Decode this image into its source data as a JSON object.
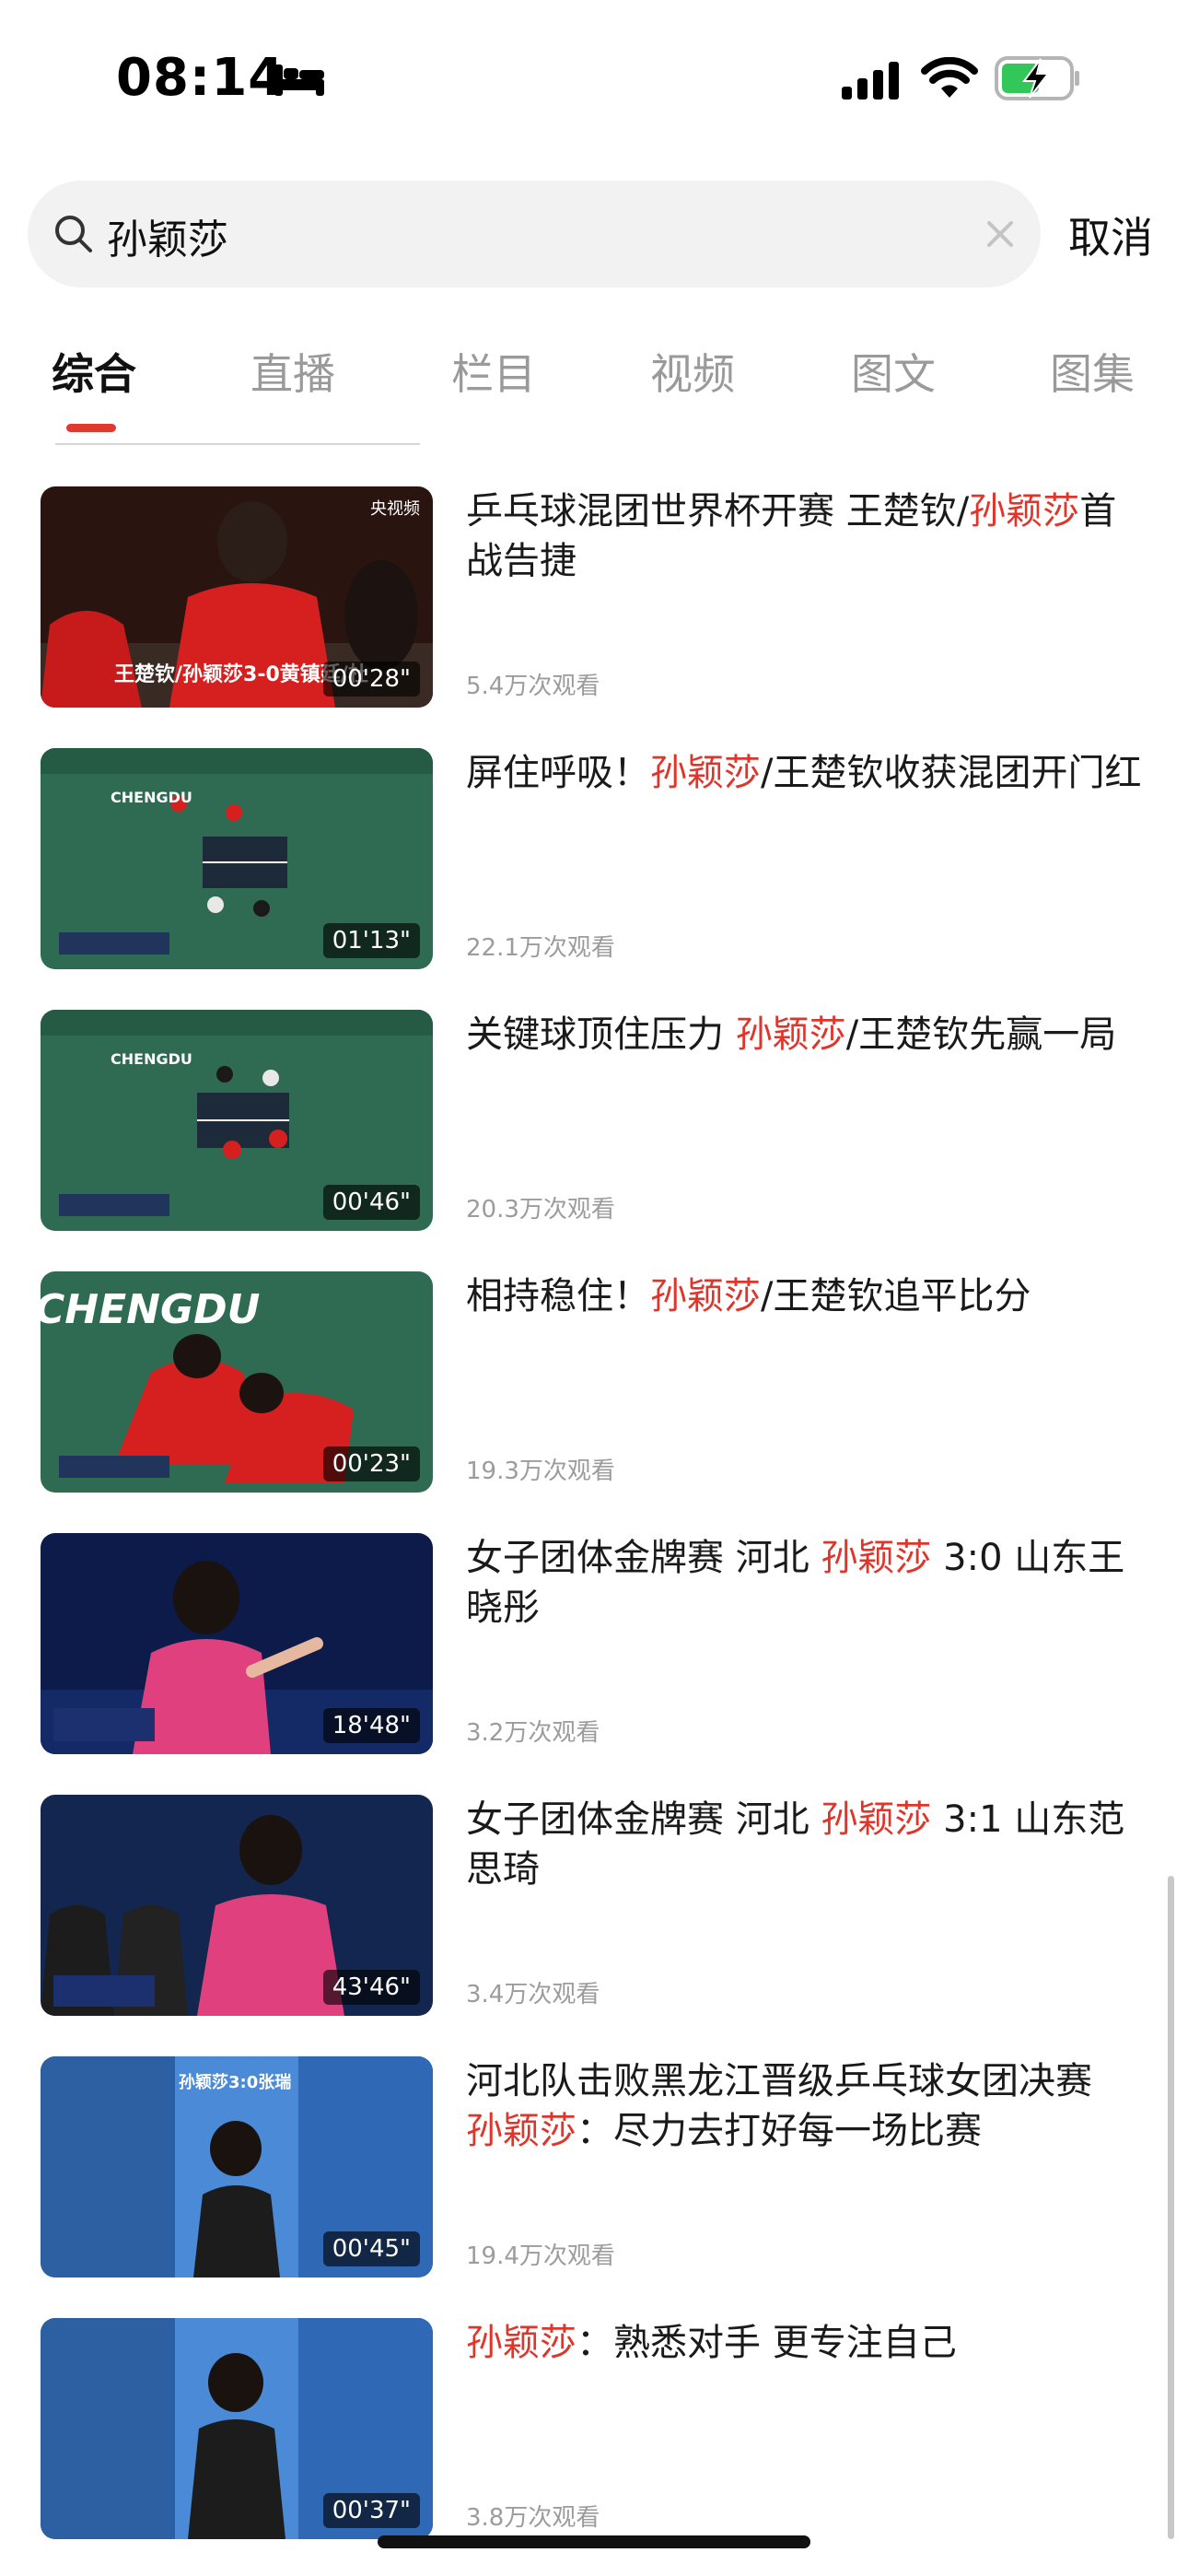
{
  "status_bar": {
    "time": "08:14"
  },
  "search": {
    "query": "孙颖莎",
    "cancel_label": "取消"
  },
  "tabs": [
    "综合",
    "直播",
    "栏目",
    "视频",
    "图文",
    "图集"
  ],
  "results": [
    {
      "title_parts": [
        "乒乓球混团世界杯开赛 王楚钦/",
        "孙颖莎",
        "首战告捷"
      ],
      "views": "5.4万次观看",
      "duration": "00'28\"",
      "overlay_text": "王楚钦/孙颖莎3-0黄镇廷/杜",
      "watermark": "央视频"
    },
    {
      "title_parts": [
        "屏住呼吸！",
        "孙颖莎",
        "/王楚钦收获混团开门红"
      ],
      "views": "22.1万次观看",
      "duration": "01'13\"",
      "court_label": "CHENGDU"
    },
    {
      "title_parts": [
        "关键球顶住压力 ",
        "孙颖莎",
        "/王楚钦先赢一局"
      ],
      "views": "20.3万次观看",
      "duration": "00'46\"",
      "court_label": "CHENGDU"
    },
    {
      "title_parts": [
        "相持稳住！",
        "孙颖莎",
        "/王楚钦追平比分"
      ],
      "views": "19.3万次观看",
      "duration": "00'23\"",
      "court_label": "CHENGDU"
    },
    {
      "title_parts": [
        "女子团体金牌赛 河北 ",
        "孙颖莎",
        " 3:0 山东王晓彤"
      ],
      "views": "3.2万次观看",
      "duration": "18'48\""
    },
    {
      "title_parts": [
        "女子团体金牌赛 河北 ",
        "孙颖莎",
        " 3:1 山东范思琦"
      ],
      "views": "3.4万次观看",
      "duration": "43'46\""
    },
    {
      "title_parts": [
        "河北队击败黑龙江晋级乒乓球女团决赛",
        "孙颖莎",
        "：尽力去打好每一场比赛"
      ],
      "views": "19.4万次观看",
      "duration": "00'45\"",
      "overlay_text": "孙颖莎3:0张瑞"
    },
    {
      "title_parts": [
        "",
        "孙颖莎",
        "：熟悉对手 更专注自己"
      ],
      "views": "3.8万次观看",
      "duration": "00'37\""
    }
  ],
  "colors": {
    "accent": "#e0352b",
    "battery_green": "#33c75a"
  }
}
